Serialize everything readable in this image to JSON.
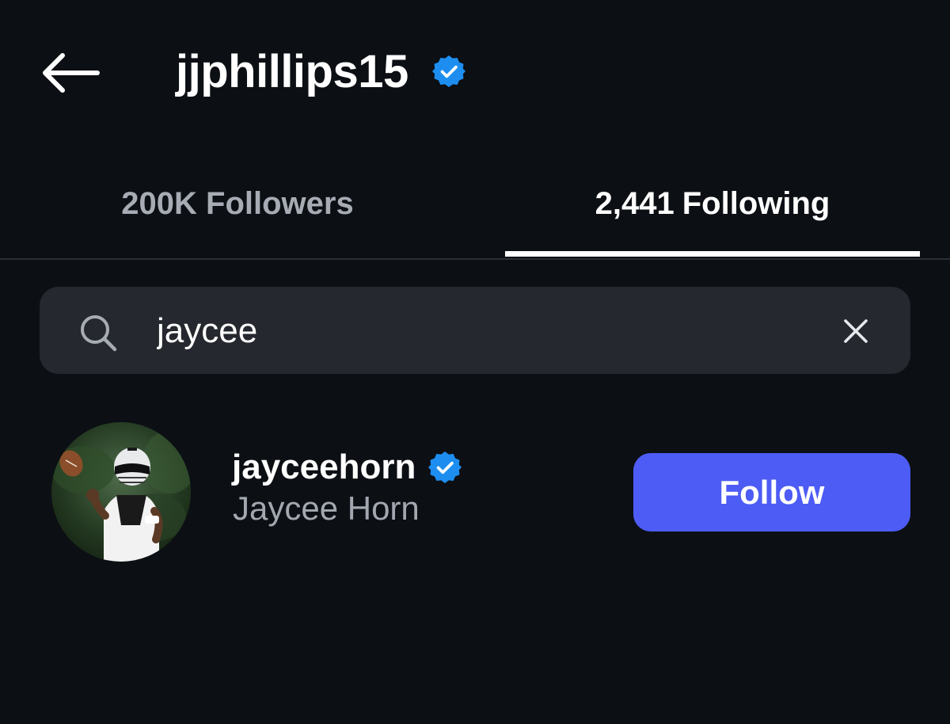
{
  "header": {
    "title": "jjphillips15",
    "back_icon": "arrow-left-icon",
    "verified_icon": "verified-badge-icon"
  },
  "tabs": [
    {
      "label": "200K Followers",
      "active": false
    },
    {
      "count": "2,441",
      "label": "Following",
      "active": true
    }
  ],
  "search": {
    "value": "jaycee",
    "placeholder": "Search",
    "search_icon": "search-icon",
    "clear_icon": "close-icon"
  },
  "results": [
    {
      "username": "jayceehorn",
      "full_name": "Jaycee Horn",
      "verified": true,
      "button_label": "Follow"
    }
  ],
  "colors": {
    "background": "#0c0f14",
    "search_bg": "#25282e",
    "follow_button": "#4d5cf5",
    "verified_badge": "#1d8ef0",
    "secondary_text": "#a3a8b0"
  }
}
